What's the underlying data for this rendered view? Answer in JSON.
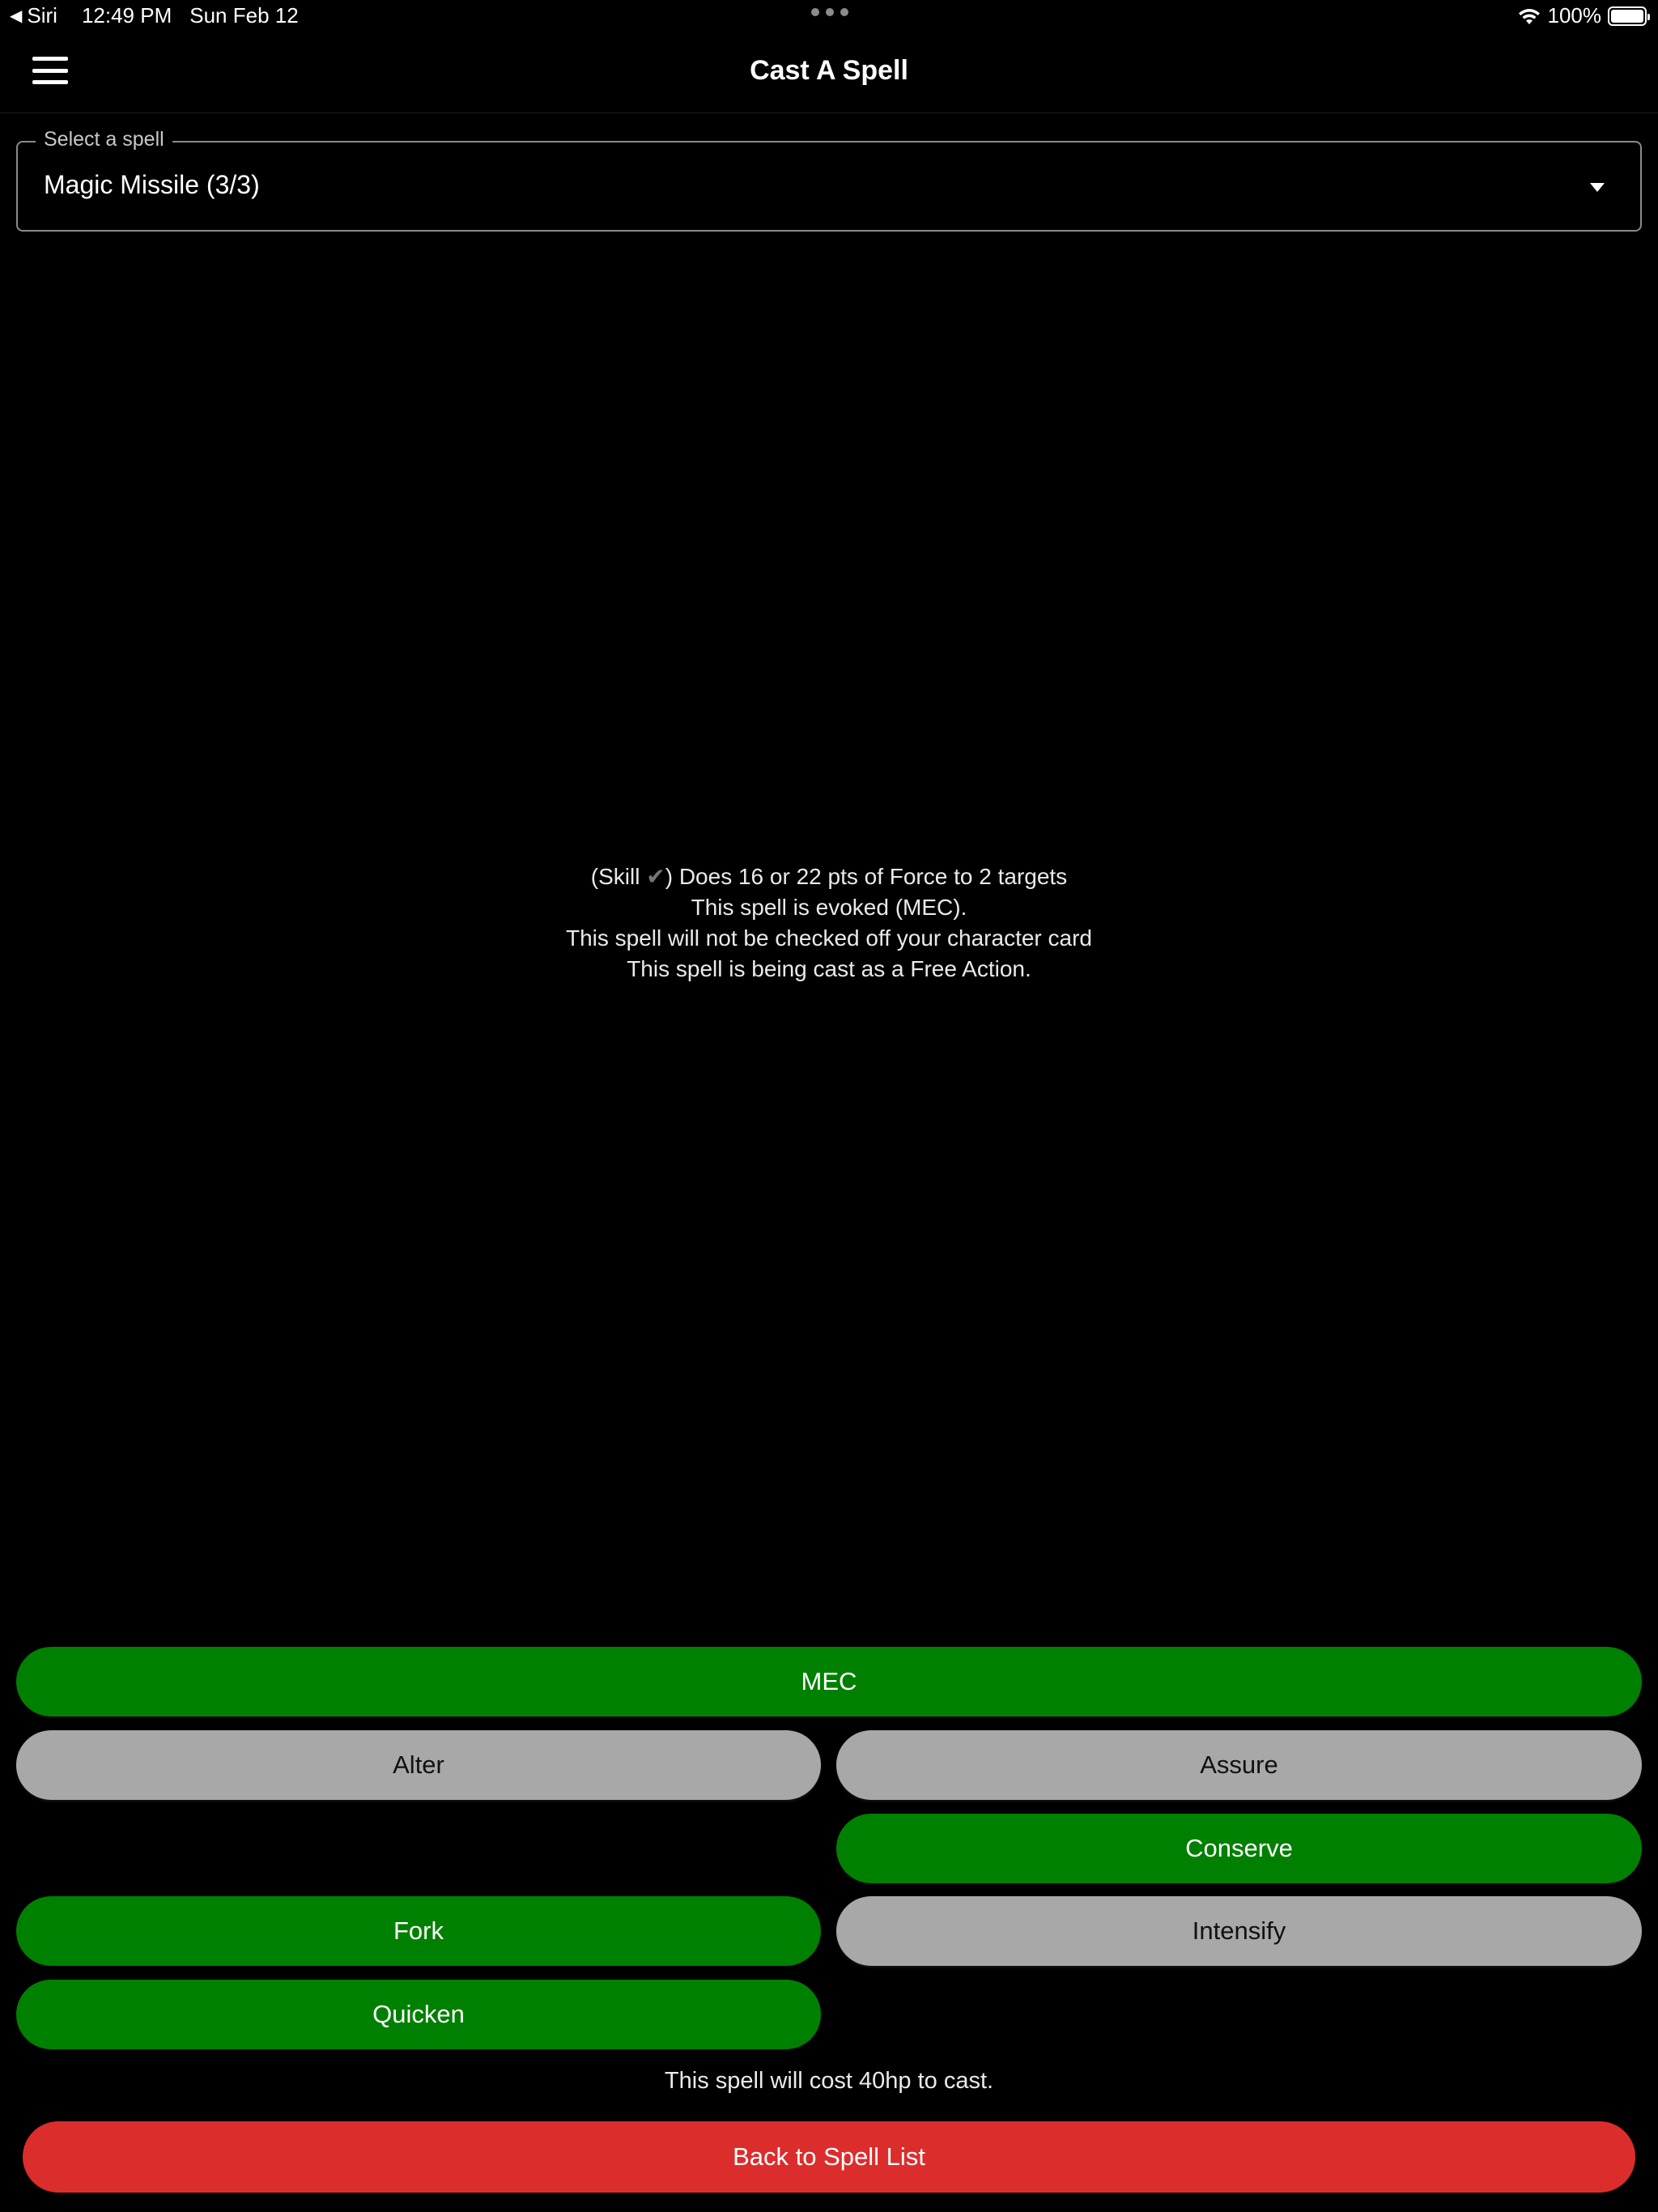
{
  "status_bar": {
    "back_app": "Siri",
    "time": "12:49 PM",
    "date": "Sun Feb 12",
    "battery": "100%"
  },
  "header": {
    "title": "Cast A Spell"
  },
  "spell_select": {
    "label": "Select a spell",
    "value": "Magic Missile (3/3)"
  },
  "description": {
    "line1_prefix": "(Skill ",
    "line1_check": "✔",
    "line1_suffix": ") Does 16 or 22 pts of Force to 2 targets",
    "line2": "This spell is evoked (MEC).",
    "line3": "This spell will not be checked off your character card",
    "line4": "This spell is being cast as a Free Action."
  },
  "modifiers": {
    "mec": {
      "label": "MEC",
      "active": true
    },
    "alter": {
      "label": "Alter",
      "active": false
    },
    "assure": {
      "label": "Assure",
      "active": false
    },
    "conserve": {
      "label": "Conserve",
      "active": true
    },
    "fork": {
      "label": "Fork",
      "active": true
    },
    "intensify": {
      "label": "Intensify",
      "active": false
    },
    "quicken": {
      "label": "Quicken",
      "active": true
    }
  },
  "cost_text": "This spell will cost 40hp to cast.",
  "back_button": "Back to Spell List",
  "colors": {
    "active": "#008000",
    "inactive": "#a8a8a8",
    "danger": "#dc2d2d",
    "background": "#000000"
  }
}
